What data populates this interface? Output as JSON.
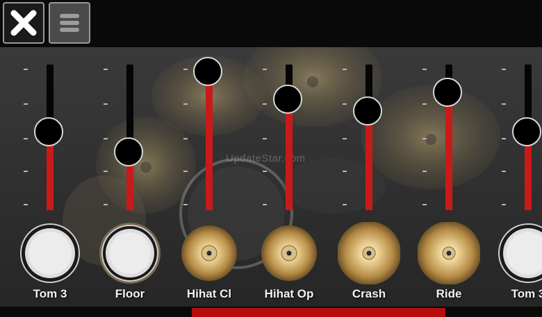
{
  "toolbar": {
    "close_icon": "close-x-icon",
    "menu_icon": "hamburger-menu-icon"
  },
  "watermark": "UpdateStar.com",
  "channels": [
    {
      "label": "Tom 3",
      "level": 0.54,
      "pad": "tom"
    },
    {
      "label": "Floor",
      "level": 0.4,
      "pad": "floor"
    },
    {
      "label": "Hihat Cl",
      "level": 0.95,
      "pad": "hihat"
    },
    {
      "label": "Hihat Op",
      "level": 0.76,
      "pad": "hihat"
    },
    {
      "label": "Crash",
      "level": 0.68,
      "pad": "crash"
    },
    {
      "label": "Ride",
      "level": 0.81,
      "pad": "ride"
    },
    {
      "label": "Tom 3",
      "level": 0.54,
      "pad": "tom"
    }
  ],
  "colors": {
    "fader_fill": "#c91a1a",
    "scrollbar": "#b80d0d",
    "background": "#2f2f2f"
  },
  "scrollbar": {
    "position": 0.35,
    "visible_fraction": 0.47
  }
}
